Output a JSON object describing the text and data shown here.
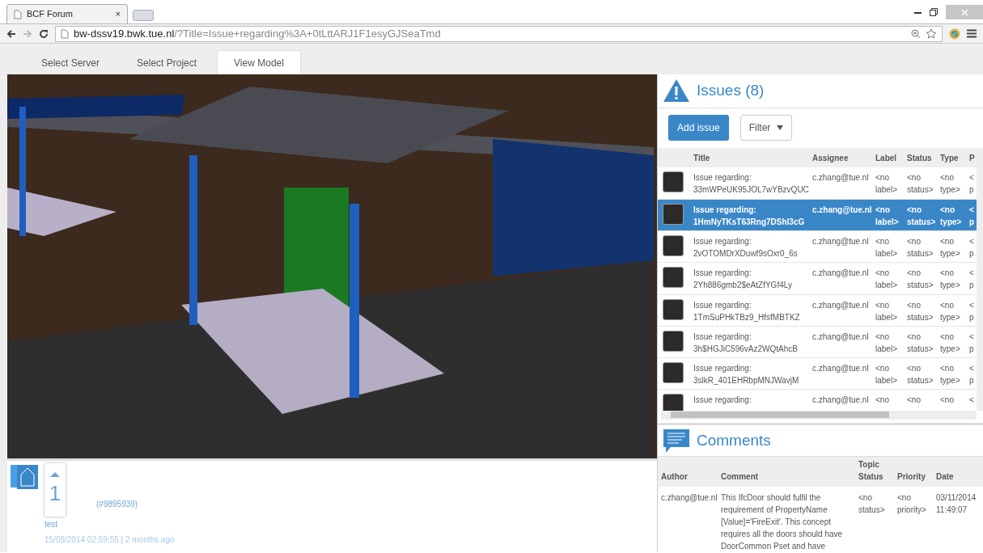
{
  "browser": {
    "tab_title": "BCF Forum",
    "tab_close": "×",
    "url_host": "bw-dssv19.bwk.tue.nl",
    "url_path": "/?Title=Issue+regarding%3A+0tLttARJ1F1esyGJSeaTmd"
  },
  "app_tabs": [
    {
      "label": "Select Server",
      "selected": false
    },
    {
      "label": "Select Project",
      "selected": false
    },
    {
      "label": "View Model",
      "selected": true
    }
  ],
  "issues": {
    "title": "Issues (8)",
    "add_button": "Add issue",
    "filter_button": "Filter",
    "columns": [
      "Title",
      "Assignee",
      "Label",
      "Status",
      "Type",
      "P"
    ],
    "rows": [
      {
        "title": "Issue regarding: 33mWPeUK95JOL7wYBzvQUC",
        "assignee": "c.zhang@tue.nl",
        "label": "<no label>",
        "status": "<no status>",
        "type": "<no type>",
        "column_6": "< p",
        "selected": false
      },
      {
        "title": "Issue regarding: 1HmNyTKsT63Rng7DShl3cG",
        "assignee": "c.zhang@tue.nl",
        "label": "<no label>",
        "status": "<no status>",
        "type": "<no type>",
        "column_6": "< p",
        "selected": true
      },
      {
        "title": "Issue regarding: 2vOTOMDrXDuwf9sOxr0_6s",
        "assignee": "c.zhang@tue.nl",
        "label": "<no label>",
        "status": "<no status>",
        "type": "<no type>",
        "column_6": "< p",
        "selected": false
      },
      {
        "title": "Issue regarding: 2Yh886gmb2$eAtZfYGf4Ly",
        "assignee": "c.zhang@tue.nl",
        "label": "<no label>",
        "status": "<no status>",
        "type": "<no type>",
        "column_6": "< p",
        "selected": false
      },
      {
        "title": "Issue regarding: 1TmSuPHkTBz9_HfsfMBTKZ",
        "assignee": "c.zhang@tue.nl",
        "label": "<no label>",
        "status": "<no status>",
        "type": "<no type>",
        "column_6": "< p",
        "selected": false
      },
      {
        "title": "Issue regarding: 3h$HGJiC596vAz2WQtAhcB",
        "assignee": "c.zhang@tue.nl",
        "label": "<no label>",
        "status": "<no status>",
        "type": "<no type>",
        "column_6": "< p",
        "selected": false
      },
      {
        "title": "Issue regarding: 3slkR_401EHRbpMNJWavjM",
        "assignee": "c.zhang@tue.nl",
        "label": "<no label>",
        "status": "<no status>",
        "type": "<no type>",
        "column_6": "< p",
        "selected": false
      },
      {
        "title": "Issue regarding:",
        "assignee": "c.zhang@tue.nl",
        "label": "<no",
        "status": "<no",
        "type": "<no",
        "column_6": "<",
        "selected": false
      }
    ]
  },
  "comments": {
    "title": "Comments",
    "columns": [
      "Author",
      "Comment",
      "Topic Status",
      "Priority",
      "Date"
    ],
    "rows": [
      {
        "author": "c.zhang@tue.nl",
        "comment": "This IfcDoor should fulfil the requirement of PropertyName [Value]='FireExit'. This concept requires all the doors should have DoorCommon Pset and have",
        "topic_status": "<no status>",
        "priority": "<no priority>",
        "date": "03/11/2014 11:49:07"
      }
    ]
  },
  "post": {
    "votes": "1",
    "reference": "(#9895939)",
    "text": "test",
    "meta": "15/09/2014 02:59:55 | 2 months ago"
  }
}
